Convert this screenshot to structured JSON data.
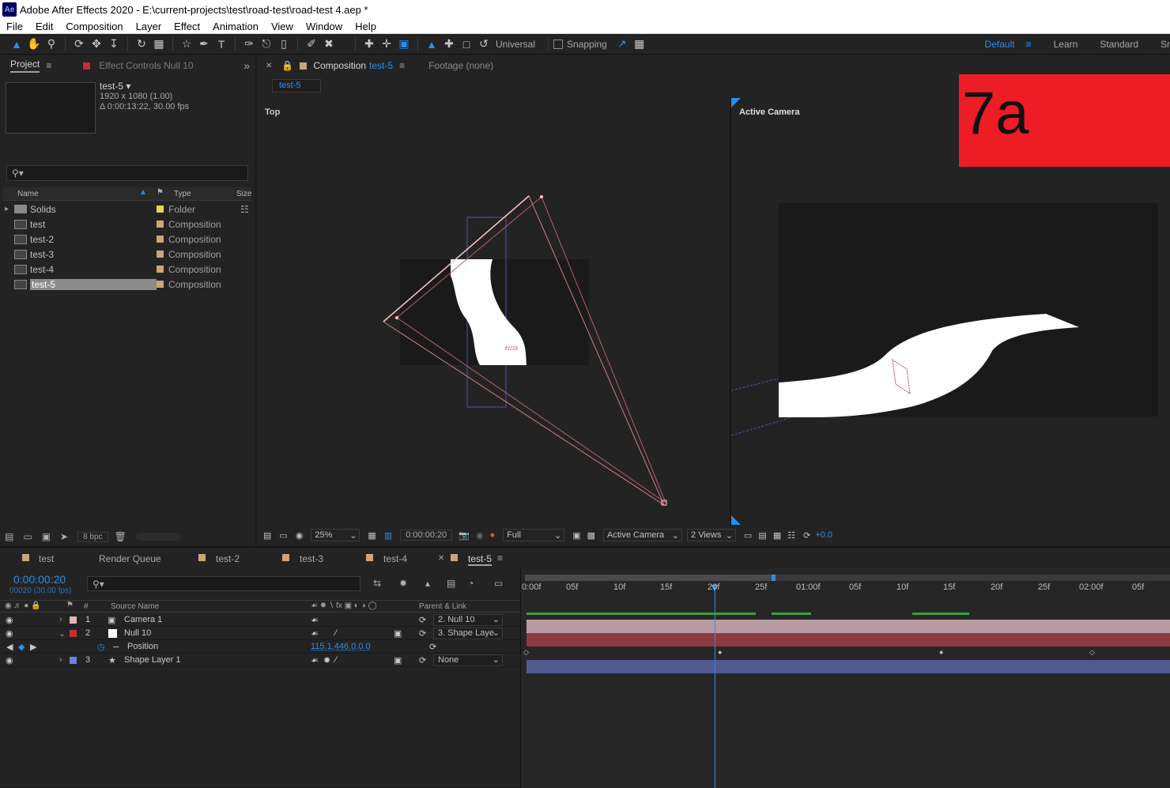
{
  "window": {
    "title": "Adobe After Effects 2020 - E:\\current-projects\\test\\road-test\\road-test 4.aep *",
    "logo": "Ae"
  },
  "menu": [
    "File",
    "Edit",
    "Composition",
    "Layer",
    "Effect",
    "Animation",
    "View",
    "Window",
    "Help"
  ],
  "toolbar": {
    "universal_label": "Universal",
    "snapping_label": "Snapping",
    "workspaces": [
      "Default",
      "Learn",
      "Standard",
      "Sr"
    ]
  },
  "project_panel": {
    "tab_project": "Project",
    "tab_effect_controls": "Effect Controls Null 10",
    "selected_name": "test-5 ▾",
    "selected_res": "1920 x 1080 (1.00)",
    "selected_dur": "Δ 0:00:13:22, 30.00 fps",
    "col_name": "Name",
    "col_type": "Type",
    "col_size": "Size",
    "items": [
      {
        "name": "Solids",
        "type": "Folder",
        "color": "#e8d84c"
      },
      {
        "name": "test",
        "type": "Composition",
        "color": "#c8a878"
      },
      {
        "name": "test-2",
        "type": "Composition",
        "color": "#c8a878"
      },
      {
        "name": "test-3",
        "type": "Composition",
        "color": "#c8a878"
      },
      {
        "name": "test-4",
        "type": "Composition",
        "color": "#c8a878"
      },
      {
        "name": "test-5",
        "type": "Composition",
        "color": "#c8a878"
      }
    ],
    "bpc": "8 bpc"
  },
  "comp_panel": {
    "tab_label": "Composition",
    "tab_comp_name": "test-5",
    "footage_tab": "Footage (none)",
    "breadcrumb": "test-5",
    "view_left_label": "Top",
    "view_right_label": "Active Camera",
    "overlay_badge": "7a",
    "zoom": "25%",
    "timecode": "0:00:00:20",
    "resolution": "Full",
    "camera": "Active Camera",
    "views": "2 Views",
    "exposure": "+0.0"
  },
  "timeline": {
    "tabs": [
      "test",
      "Render Queue",
      "test-2",
      "test-3",
      "test-4",
      "test-5"
    ],
    "timecode": "0:00:00:20",
    "frame_info": "00020 (30.00 fps)",
    "col_source": "Source Name",
    "col_parent": "Parent & Link",
    "layers": [
      {
        "num": "1",
        "name": "Camera 1",
        "color": "#e8b0b8",
        "parent": "2. Null 10"
      },
      {
        "num": "2",
        "name": "Null 10",
        "color": "#c03030",
        "parent": "3. Shape Laye"
      },
      {
        "num": "3",
        "name": "Shape Layer 1",
        "color": "#7080e0",
        "parent": "None"
      }
    ],
    "position_label": "Position",
    "position_value": "115.1,446.0,0.0",
    "ruler": [
      "0:00f",
      "05f",
      "10f",
      "15f",
      "20f",
      "25f",
      "01:00f",
      "05f",
      "10f",
      "15f",
      "20f",
      "25f",
      "02:00f",
      "05f"
    ]
  }
}
